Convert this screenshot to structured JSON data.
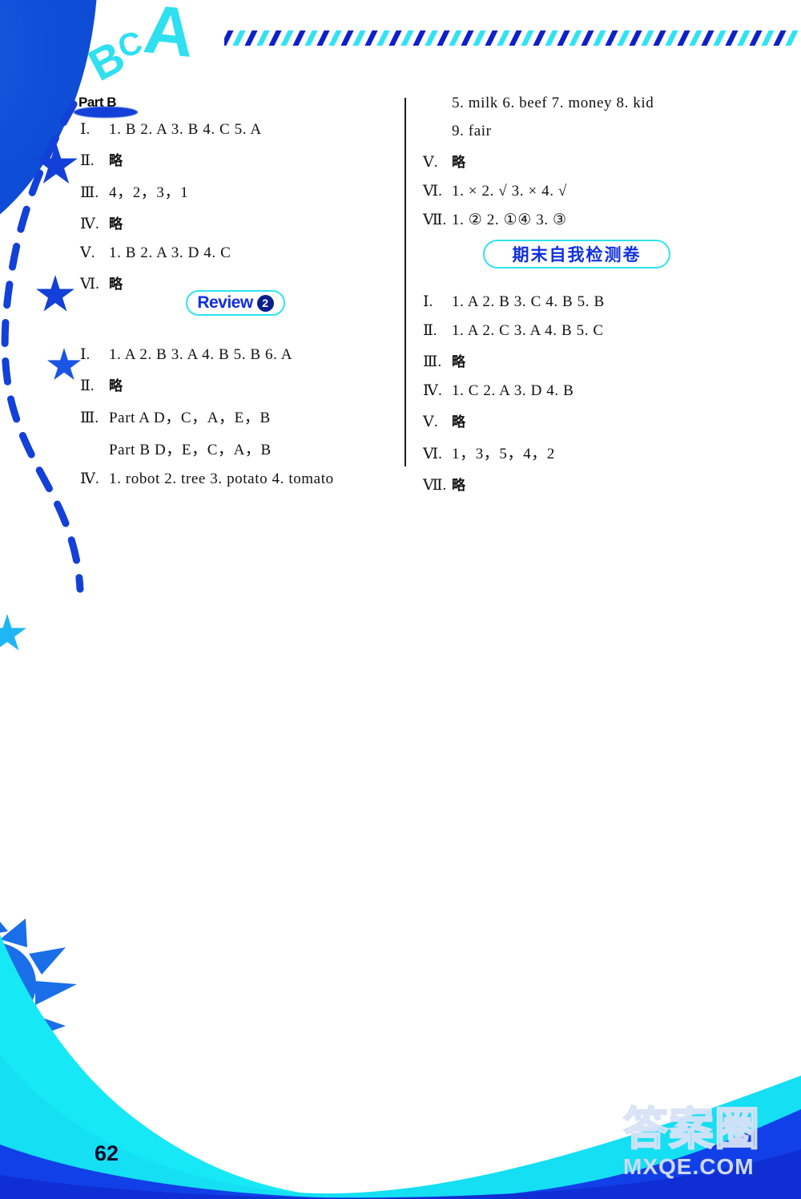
{
  "page": {
    "number": "62",
    "decor": {
      "letters": [
        "B",
        "C",
        "A"
      ],
      "dash_colors": [
        "#1020c8",
        "#2fe3f2"
      ],
      "accent_blue": "#0f4fd8",
      "accent_cyan": "#2fe3f2",
      "wave_cyan": "#17e8f5",
      "wave_blue": "#1240e8"
    }
  },
  "left_column": {
    "section_label": "Part B",
    "answers": [
      {
        "num": "Ⅰ.",
        "body": "1. B  2. A  3. B  4. C  5. A",
        "cn": false
      },
      {
        "num": "Ⅱ.",
        "body": "略",
        "cn": true
      },
      {
        "num": "Ⅲ.",
        "body": "4，2，3，1",
        "cn": false
      },
      {
        "num": "Ⅳ.",
        "body": "略",
        "cn": true
      },
      {
        "num": "Ⅴ.",
        "body": "1. B  2. A  3. D  4. C",
        "cn": false
      },
      {
        "num": "Ⅵ.",
        "body": "略",
        "cn": true
      }
    ],
    "review_badge": {
      "text": "Review",
      "number": "2"
    },
    "review_answers": [
      {
        "num": "Ⅰ.",
        "body": "1. A  2. B  3. A  4. B  5. B  6. A",
        "cn": false
      },
      {
        "num": "Ⅱ.",
        "body": "略",
        "cn": true
      },
      {
        "num": "Ⅲ.",
        "body": "Part A  D，C，A，E，B",
        "cn": false
      },
      {
        "num": "",
        "body": "Part B  D，E，C，A，B",
        "cn": false,
        "indent": true
      },
      {
        "num": "Ⅳ.",
        "body": "1. robot  2. tree  3. potato  4. tomato",
        "cn": false
      }
    ]
  },
  "right_column": {
    "continued_answers": [
      {
        "num": "",
        "body": "5. milk  6. beef  7. money  8. kid",
        "cn": false,
        "indent": true
      },
      {
        "num": "",
        "body": "9. fair",
        "cn": false,
        "indent": true
      },
      {
        "num": "Ⅴ.",
        "body": "略",
        "cn": true
      },
      {
        "num": "Ⅵ.",
        "body": "1. ×  2. √  3. ×  4. √",
        "cn": false
      },
      {
        "num": "Ⅶ.",
        "body": "1. ②  2. ①④  3. ③",
        "cn": false
      }
    ],
    "exam_badge": {
      "text": "期末自我检测卷"
    },
    "exam_answers": [
      {
        "num": "Ⅰ.",
        "body": "1. A  2. B  3. C  4. B  5. B",
        "cn": false
      },
      {
        "num": "Ⅱ.",
        "body": "1. A  2. C  3. A  4. B  5. C",
        "cn": false
      },
      {
        "num": "Ⅲ.",
        "body": "略",
        "cn": true
      },
      {
        "num": "Ⅳ.",
        "body": "1. C  2. A  3. D  4. B",
        "cn": false
      },
      {
        "num": "Ⅴ.",
        "body": "略",
        "cn": true
      },
      {
        "num": "Ⅵ.",
        "body": "1，3，5，4，2",
        "cn": false
      },
      {
        "num": "Ⅶ.",
        "body": "略",
        "cn": true
      }
    ]
  },
  "watermark": {
    "cn": "答案圈",
    "en": "MXQE.COM"
  }
}
